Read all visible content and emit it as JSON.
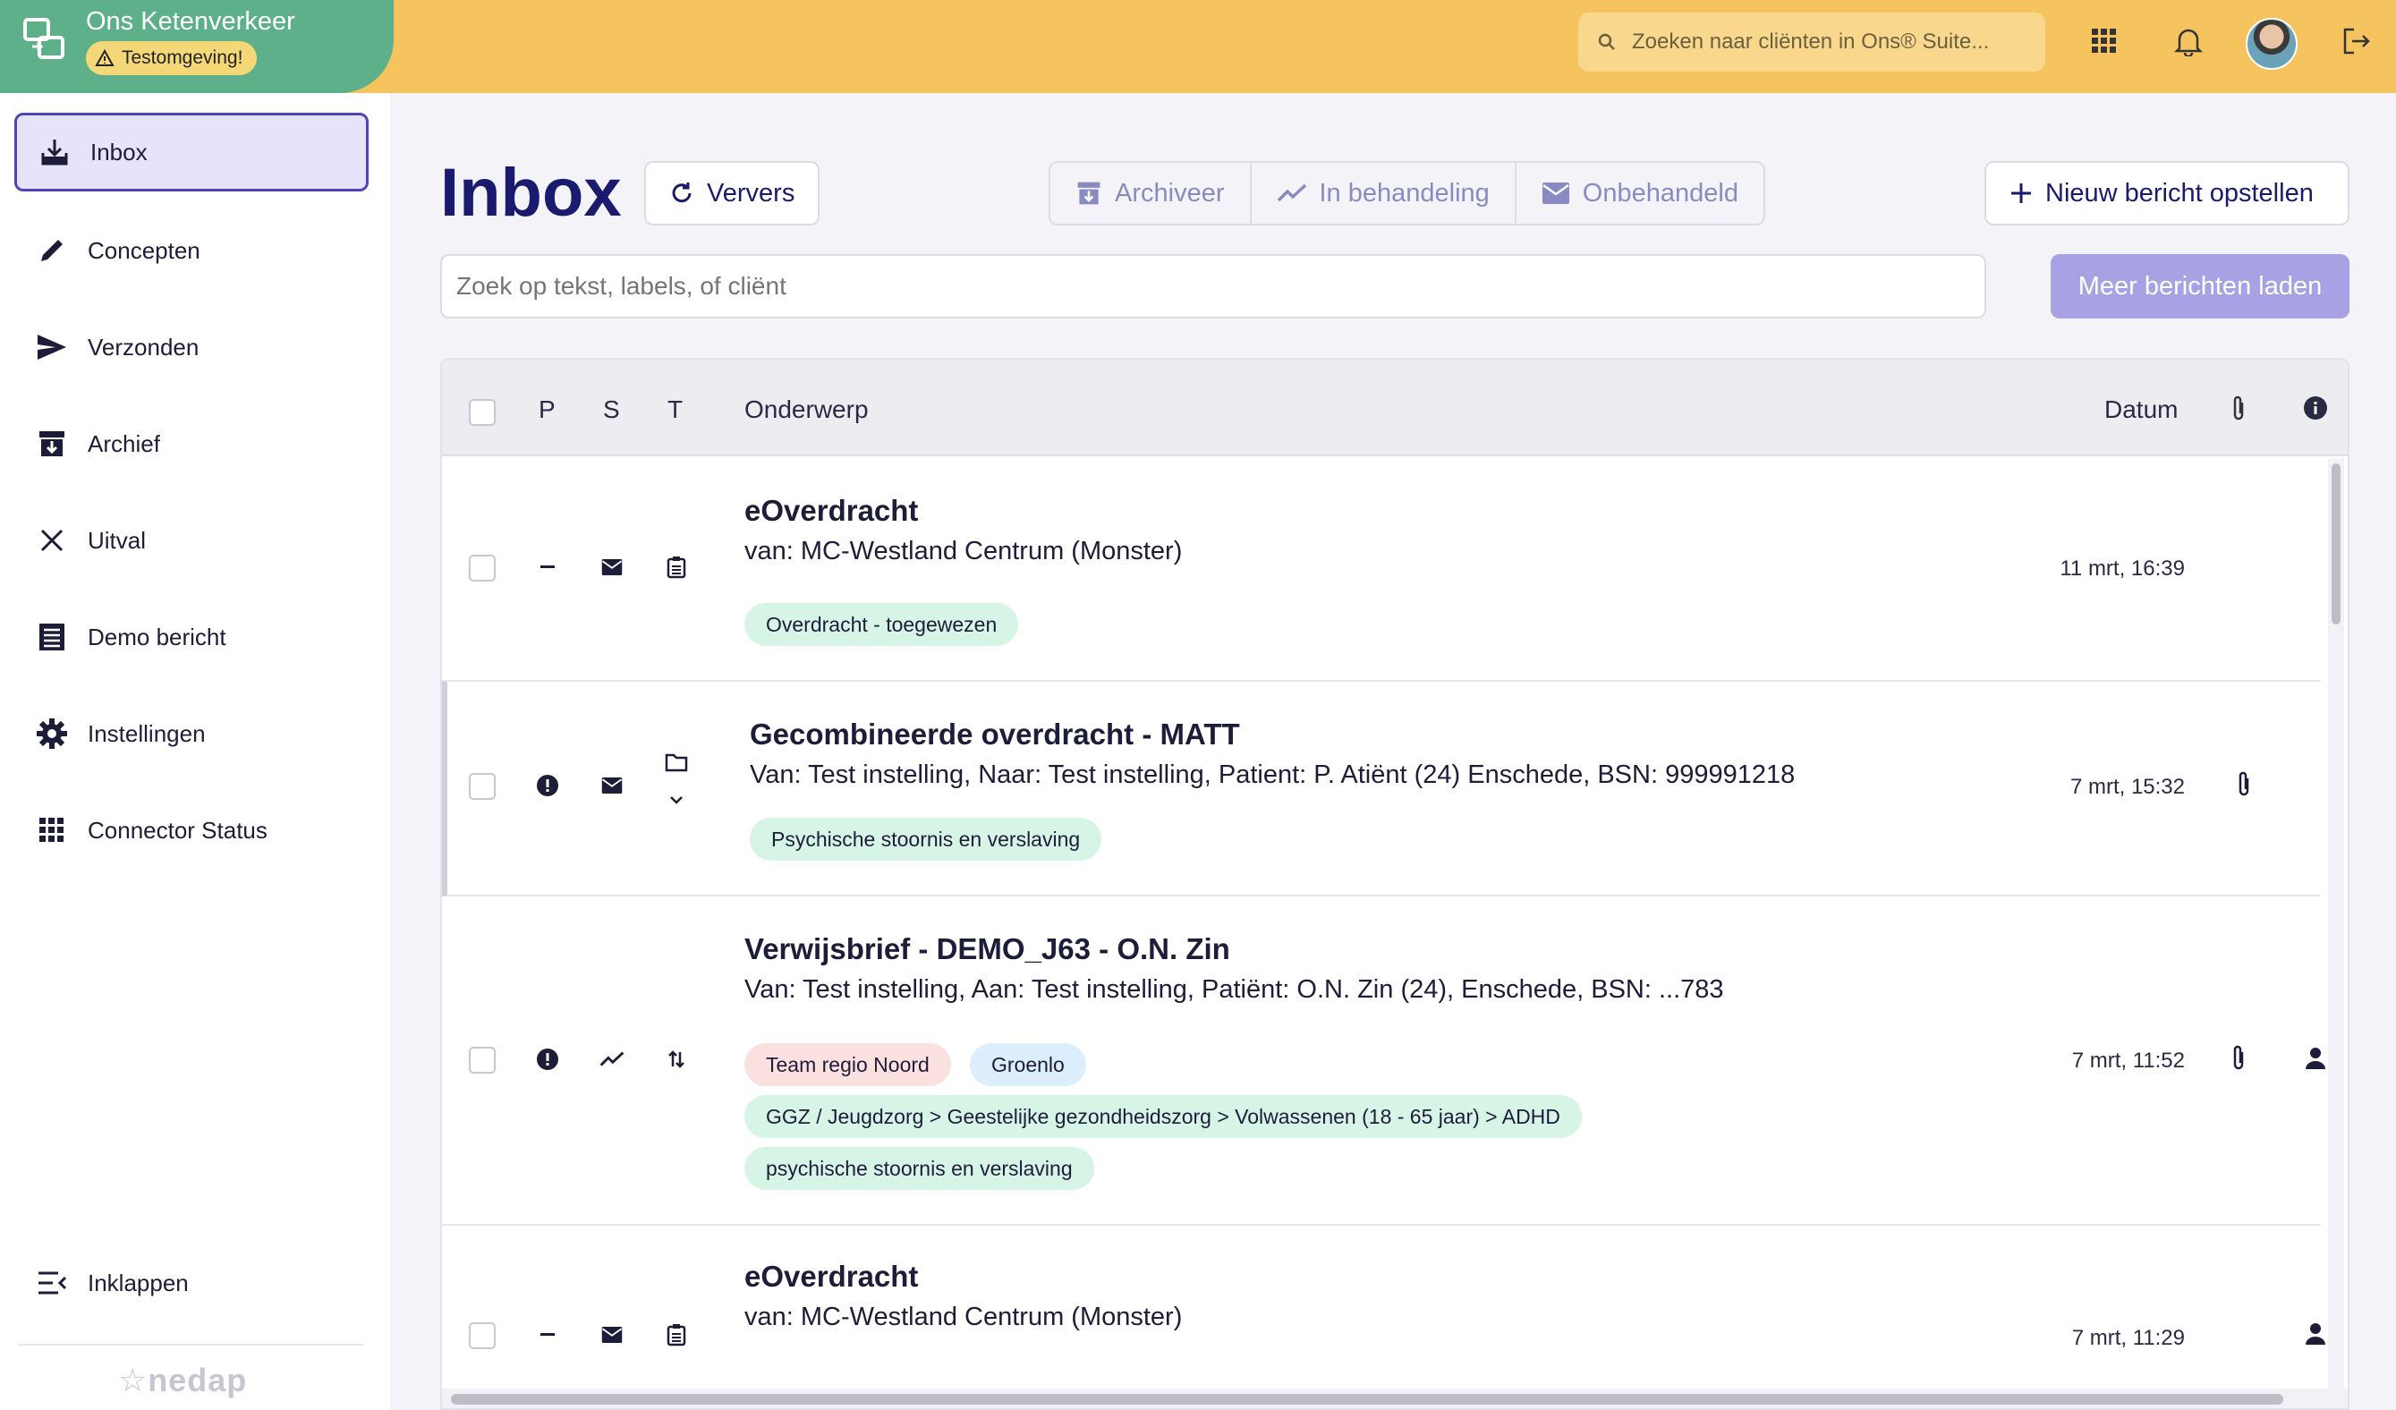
{
  "brand": {
    "title": "Ons Ketenverkeer",
    "badge": "Testomgeving!"
  },
  "topbar": {
    "search_placeholder": "Zoeken naar cliënten in Ons® Suite..."
  },
  "sidebar": {
    "items": [
      {
        "label": "Inbox",
        "icon": "inbox-download-icon",
        "active": true
      },
      {
        "label": "Concepten",
        "icon": "pencil-icon"
      },
      {
        "label": "Verzonden",
        "icon": "send-icon"
      },
      {
        "label": "Archief",
        "icon": "archive-icon"
      },
      {
        "label": "Uitval",
        "icon": "close-icon"
      },
      {
        "label": "Demo bericht",
        "icon": "document-list-icon"
      },
      {
        "label": "Instellingen",
        "icon": "gear-icon"
      },
      {
        "label": "Connector Status",
        "icon": "grid-icon"
      }
    ],
    "collapse_label": "Inklappen",
    "footer_logo": "nedap"
  },
  "main": {
    "title": "Inbox",
    "refresh_label": "Ververs",
    "segments": [
      "Archiveer",
      "In behandeling",
      "Onbehandeld"
    ],
    "new_message_label": "Nieuw bericht opstellen",
    "search_placeholder": "Zoek op tekst, labels, of cliënt",
    "load_more_label": "Meer berichten laden"
  },
  "table": {
    "headers": {
      "p": "P",
      "s": "S",
      "t": "T",
      "subject": "Onderwerp",
      "date": "Datum"
    },
    "rows": [
      {
        "title": "eOverdracht",
        "subtitle": "van: MC-Westland Centrum (Monster)",
        "date": "11 mrt, 16:39",
        "priority": "dash-icon",
        "status": "envelope-icon",
        "type": "clipboard-icon",
        "tags": [
          {
            "text": "Overdracht - toegewezen",
            "color": "#d7f5e6"
          }
        ]
      },
      {
        "title": "Gecombineerde overdracht - MATT",
        "subtitle": "Van: Test instelling, Naar: Test instelling, Patient: P. Atiënt (24) Enschede, BSN: 999991218",
        "date": "7 mrt, 15:32",
        "priority": "alert-icon",
        "status": "envelope-icon",
        "type": "folder-icon",
        "tags": [
          {
            "text": "Psychische stoornis en verslaving",
            "color": "#d7f5e6"
          }
        ]
      },
      {
        "title": "Verwijsbrief - DEMO_J63 - O.N. Zin",
        "subtitle": "Van: Test instelling, Aan: Test instelling, Patiënt: O.N. Zin (24), Enschede, BSN: ...783",
        "date": "7 mrt, 11:52",
        "priority": "alert-icon",
        "status": "trend-icon",
        "type": "transfer-icon",
        "tags": [
          {
            "text": "Team regio Noord",
            "color": "#fbe0e0"
          },
          {
            "text": "Groenlo",
            "color": "#dcedfb"
          },
          {
            "text": "GGZ / Jeugdzorg > Geestelijke gezondheidszorg > Volwassenen (18 - 65 jaar) > ADHD",
            "color": "#d7f5e6"
          },
          {
            "text": "psychische stoornis en verslaving",
            "color": "#d7f5e6"
          }
        ]
      },
      {
        "title": "eOverdracht",
        "subtitle": "van: MC-Westland Centrum (Monster)",
        "date": "7 mrt, 11:29",
        "priority": "dash-icon",
        "status": "envelope-icon",
        "type": "clipboard-icon",
        "tags": []
      }
    ]
  }
}
